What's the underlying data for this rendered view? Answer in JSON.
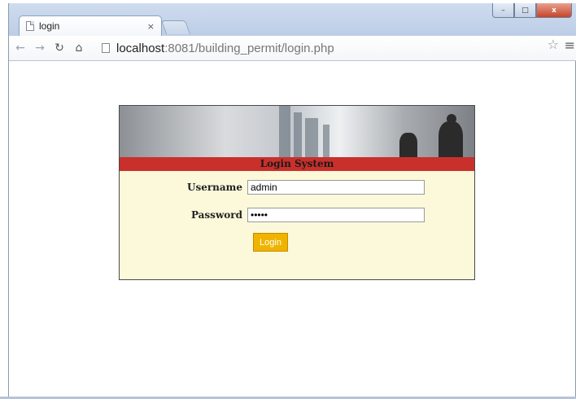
{
  "browser": {
    "tab_title": "login",
    "tab_close": "×",
    "url_host": "localhost",
    "url_rest": ":8081/building_permit/login.php",
    "star_icon": "star-icon",
    "menu_icon": "menu-icon"
  },
  "window_controls": {
    "minimize": "–",
    "maximize": "□",
    "close": "x"
  },
  "login": {
    "title": "Login System",
    "username_label": "Username",
    "username_value": "admin",
    "password_label": "Password",
    "password_value": "•••••",
    "button_label": "Login"
  },
  "colors": {
    "title_bar": "#c9302c",
    "form_bg": "#fbf9da",
    "button": "#f0b400"
  }
}
